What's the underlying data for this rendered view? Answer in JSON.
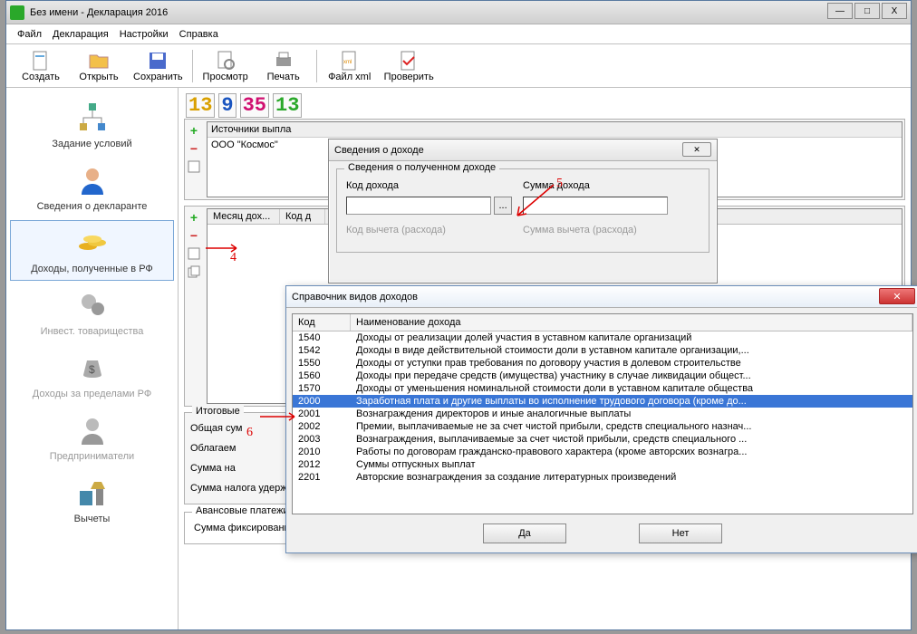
{
  "window": {
    "title": "Без имени - Декларация 2016"
  },
  "menu": {
    "file": "Файл",
    "decl": "Декларация",
    "settings": "Настройки",
    "help": "Справка"
  },
  "toolbar": {
    "create": "Создать",
    "open": "Открыть",
    "save": "Сохранить",
    "preview": "Просмотр",
    "print": "Печать",
    "xml": "Файл xml",
    "check": "Проверить"
  },
  "sidebar": {
    "conditions": "Задание условий",
    "declarant": "Сведения о декларанте",
    "income_rf": "Доходы, полученные в РФ",
    "invest": "Инвест. товарищества",
    "income_abroad": "Доходы за пределами РФ",
    "entrepreneur": "Предприниматели",
    "deductions": "Вычеты"
  },
  "digits": {
    "a": "13",
    "b": "9",
    "c": "35",
    "d": "13"
  },
  "sources": {
    "header": "Источники выпла",
    "item": "ООО \"Космос\""
  },
  "months": {
    "col1": "Месяц дох...",
    "col2": "Код д"
  },
  "totals": {
    "group": "Итоговые",
    "total_sum": "Общая сум",
    "taxable": "Облагаем",
    "tax_calc": "Сумма на",
    "tax_held": "Сумма налога удержанная"
  },
  "advance": {
    "group": "Авансовые платежи иностранца",
    "fixed": "Сумма фиксированных платежей"
  },
  "dlg1": {
    "title": "Сведения о доходе",
    "group": "Сведения о полученном доходе",
    "code": "Код дохода",
    "sum": "Сумма дохода",
    "code2": "Код вычета (расхода)",
    "sum2": "Сумма вычета (расхода)"
  },
  "dlg2": {
    "title": "Справочник видов доходов",
    "col_code": "Код",
    "col_name": "Наименование дохода",
    "ok": "Да",
    "cancel": "Нет",
    "rows": [
      {
        "code": "1540",
        "name": "Доходы от реализации долей участия в уставном капитале организаций"
      },
      {
        "code": "1542",
        "name": "Доходы в виде действительной стоимости доли в уставном капитале организации,..."
      },
      {
        "code": "1550",
        "name": "Доходы от уступки прав требования по договору участия в долевом строительстве"
      },
      {
        "code": "1560",
        "name": "Доходы при передаче средств (имущества) участнику в случае ликвидации общест..."
      },
      {
        "code": "1570",
        "name": "Доходы от уменьшения номинальной стоимости доли в уставном капитале общества"
      },
      {
        "code": "2000",
        "name": "Заработная плата и другие выплаты во исполнение трудового договора (кроме до..."
      },
      {
        "code": "2001",
        "name": "Вознаграждения директоров и иные аналогичные выплаты"
      },
      {
        "code": "2002",
        "name": "Премии, выплачиваемые не за счет чистой прибыли, средств специального назнач..."
      },
      {
        "code": "2003",
        "name": "Вознаграждения, выплачиваемые за счет чистой прибыли, средств специального ..."
      },
      {
        "code": "2010",
        "name": "Работы по договорам гражданско-правового характера (кроме авторских вознагра..."
      },
      {
        "code": "2012",
        "name": "Суммы отпускных выплат"
      },
      {
        "code": "2201",
        "name": "Авторские вознаграждения за создание литературных произведений"
      }
    ],
    "selected_index": 5
  },
  "annotations": {
    "n4": "4",
    "n5": "5",
    "n6": "6"
  }
}
